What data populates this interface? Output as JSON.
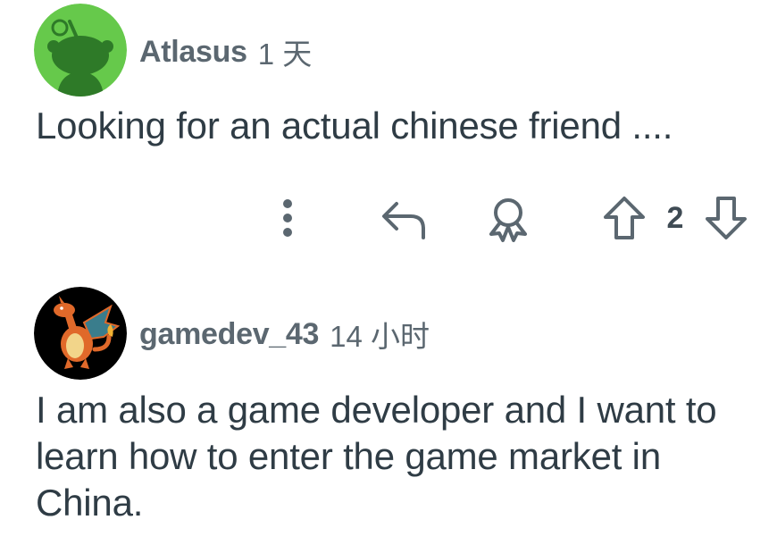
{
  "comments": [
    {
      "username": "Atlasus",
      "time": "1 天",
      "body": "Looking for an actual chinese friend ....",
      "avatar": "green-reddit-snoo-avatar",
      "score": "2",
      "actions": {
        "more": "more-options-icon",
        "reply": "reply-icon",
        "award": "award-icon",
        "upvote": "upvote-arrow-icon",
        "downvote": "downvote-arrow-icon"
      }
    },
    {
      "username": "gamedev_43",
      "time": "14 小时",
      "body": "I am also a game developer and I want to learn how to enter the game market in China.",
      "avatar": "charizard-avatar"
    }
  ],
  "colors": {
    "text": "#2f3c45",
    "meta": "#5b6770",
    "icon": "#5b6770",
    "avatar1_bg": "#66c94b",
    "avatar2_bg": "#000000"
  }
}
